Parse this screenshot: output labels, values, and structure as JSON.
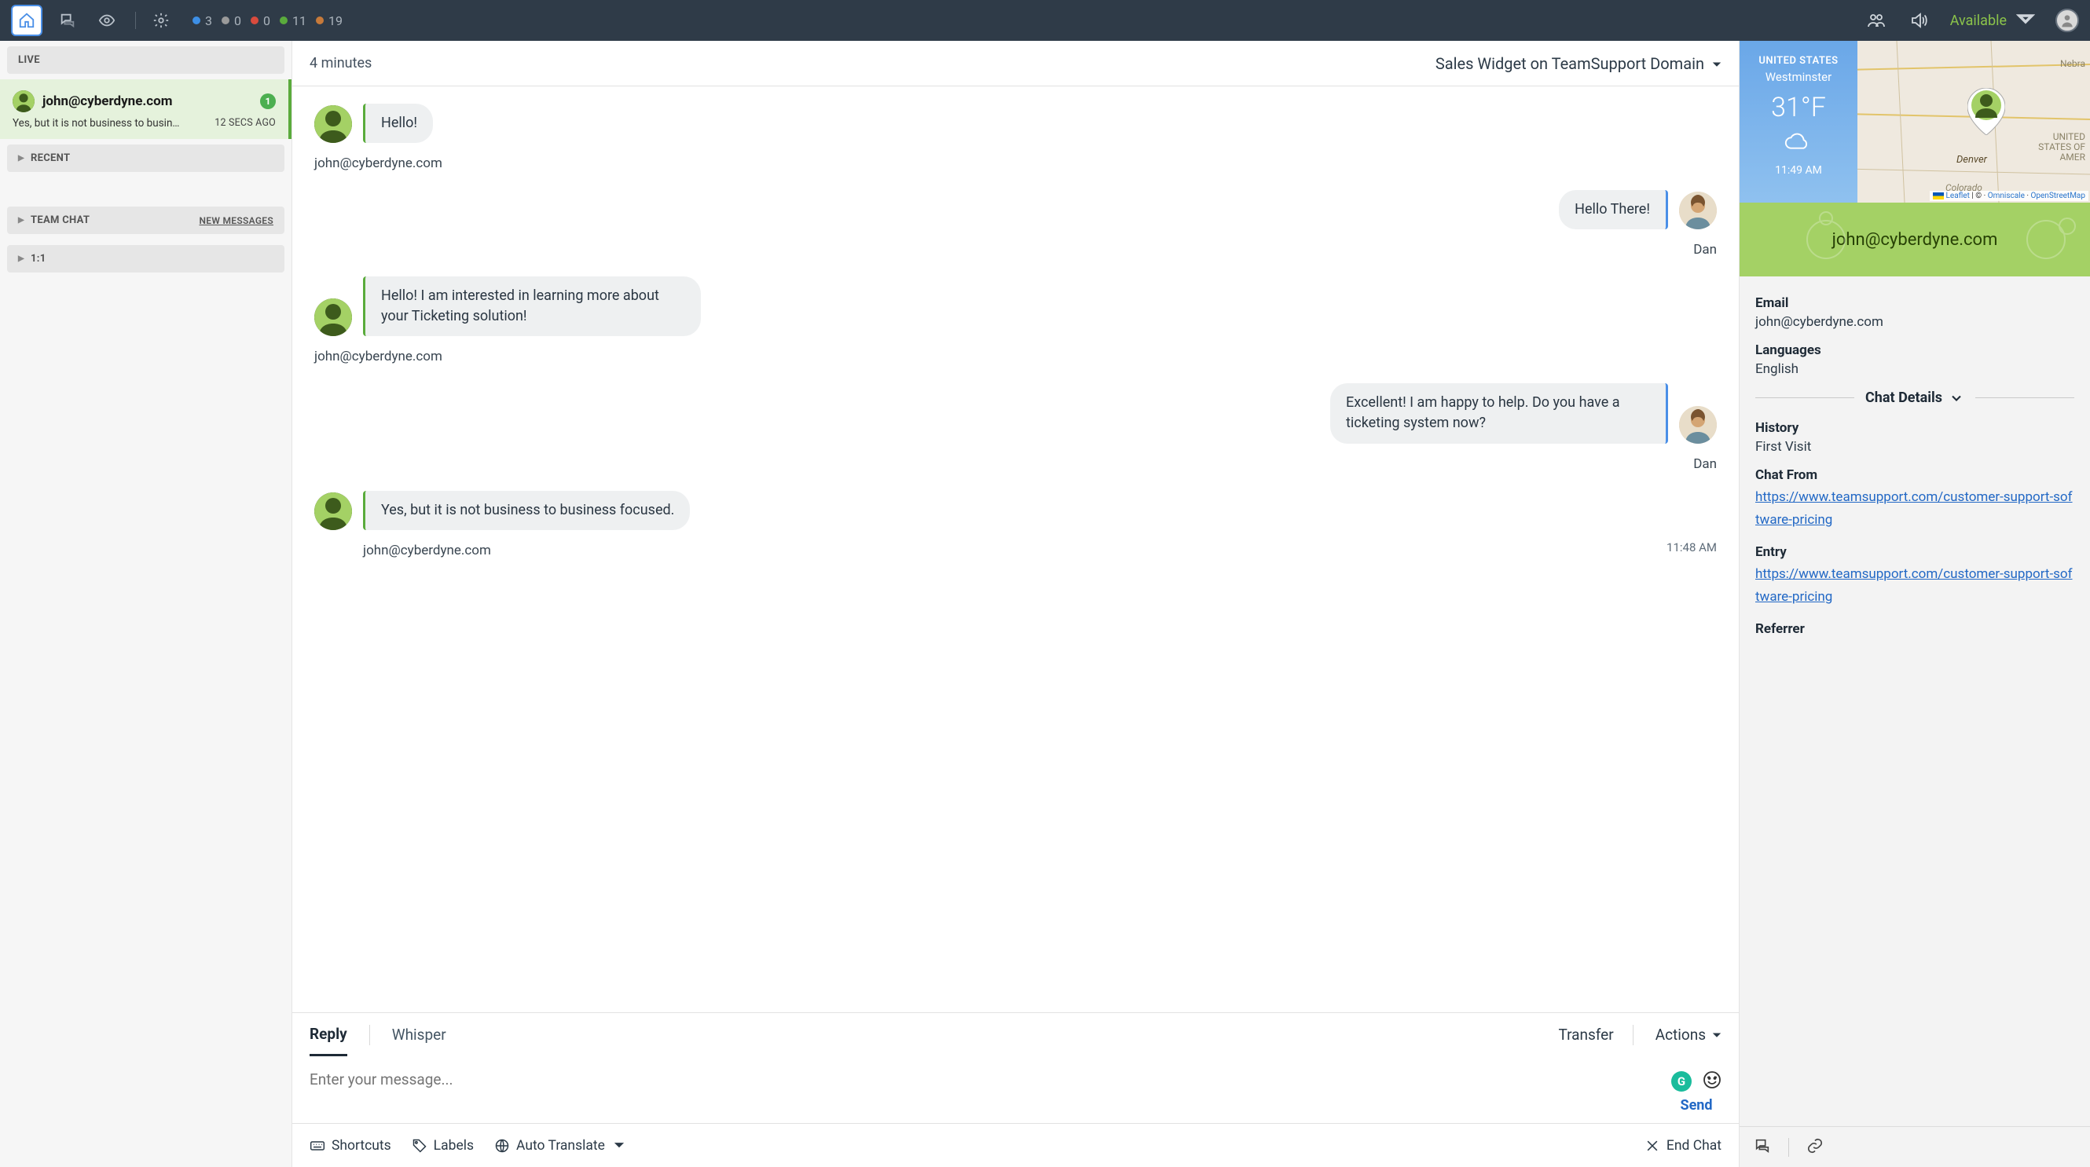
{
  "topbar": {
    "status": [
      {
        "color": "#3d8fe6",
        "count": "3"
      },
      {
        "color": "#9a9a9a",
        "count": "0"
      },
      {
        "color": "#d94b3d",
        "count": "0"
      },
      {
        "color": "#5aab3c",
        "count": "11"
      },
      {
        "color": "#c77a3a",
        "count": "19"
      }
    ],
    "availability": "Available"
  },
  "sidebar": {
    "live_label": "LIVE",
    "recent_label": "RECENT",
    "team_chat_label": "TEAM CHAT",
    "team_chat_link": "NEW MESSAGES",
    "one_on_one_label": "1:1",
    "conversation": {
      "title": "john@cyberdyne.com",
      "badge": "1",
      "preview": "Yes, but it is not business to busin…",
      "time_ago": "12 SECS AGO"
    }
  },
  "chat": {
    "duration": "4 minutes",
    "source": "Sales Widget on TeamSupport Domain",
    "messages": [
      {
        "side": "left",
        "text": "Hello!",
        "name": "john@cyberdyne.com"
      },
      {
        "side": "right",
        "text": "Hello There!",
        "name": "Dan"
      },
      {
        "side": "left",
        "text": "Hello! I am interested in learning more about your Ticketing solution!",
        "name": "john@cyberdyne.com"
      },
      {
        "side": "right",
        "text": "Excellent! I am happy to help. Do you have a ticketing system now?",
        "name": "Dan"
      },
      {
        "side": "left",
        "text": "Yes, but it is not business to business focused.",
        "name": "john@cyberdyne.com",
        "time": "11:48 AM"
      }
    ],
    "tabs": {
      "reply": "Reply",
      "whisper": "Whisper"
    },
    "transfer_label": "Transfer",
    "actions_label": "Actions",
    "placeholder": "Enter your message...",
    "send_label": "Send",
    "footer": {
      "shortcuts": "Shortcuts",
      "labels": "Labels",
      "auto_translate": "Auto Translate",
      "end_chat": "End Chat"
    }
  },
  "details": {
    "weather": {
      "country": "UNITED STATES",
      "city": "Westminster",
      "temp": "31°F",
      "time": "11:49 AM"
    },
    "map": {
      "city": "Denver",
      "state": "Colorado",
      "neighbor": "Nebra",
      "country_label": "UNITED STATES OF AMER"
    },
    "attribution": {
      "leaflet": "Leaflet",
      "omniscale": "Omniscale",
      "osm": "OpenStreetMap"
    },
    "visitor_email": "john@cyberdyne.com",
    "email_label": "Email",
    "email_value": "john@cyberdyne.com",
    "languages_label": "Languages",
    "languages_value": "English",
    "chat_details_label": "Chat Details",
    "history_label": "History",
    "history_value": "First Visit",
    "chat_from_label": "Chat From",
    "chat_from_value": "https://www.teamsupport.com/customer-support-software-pricing",
    "entry_label": "Entry",
    "entry_value": "https://www.teamsupport.com/customer-support-pricing",
    "entry_display": "https://www.teamsupport.com/customer-support-software-pricing",
    "referrer_label": "Referrer"
  }
}
